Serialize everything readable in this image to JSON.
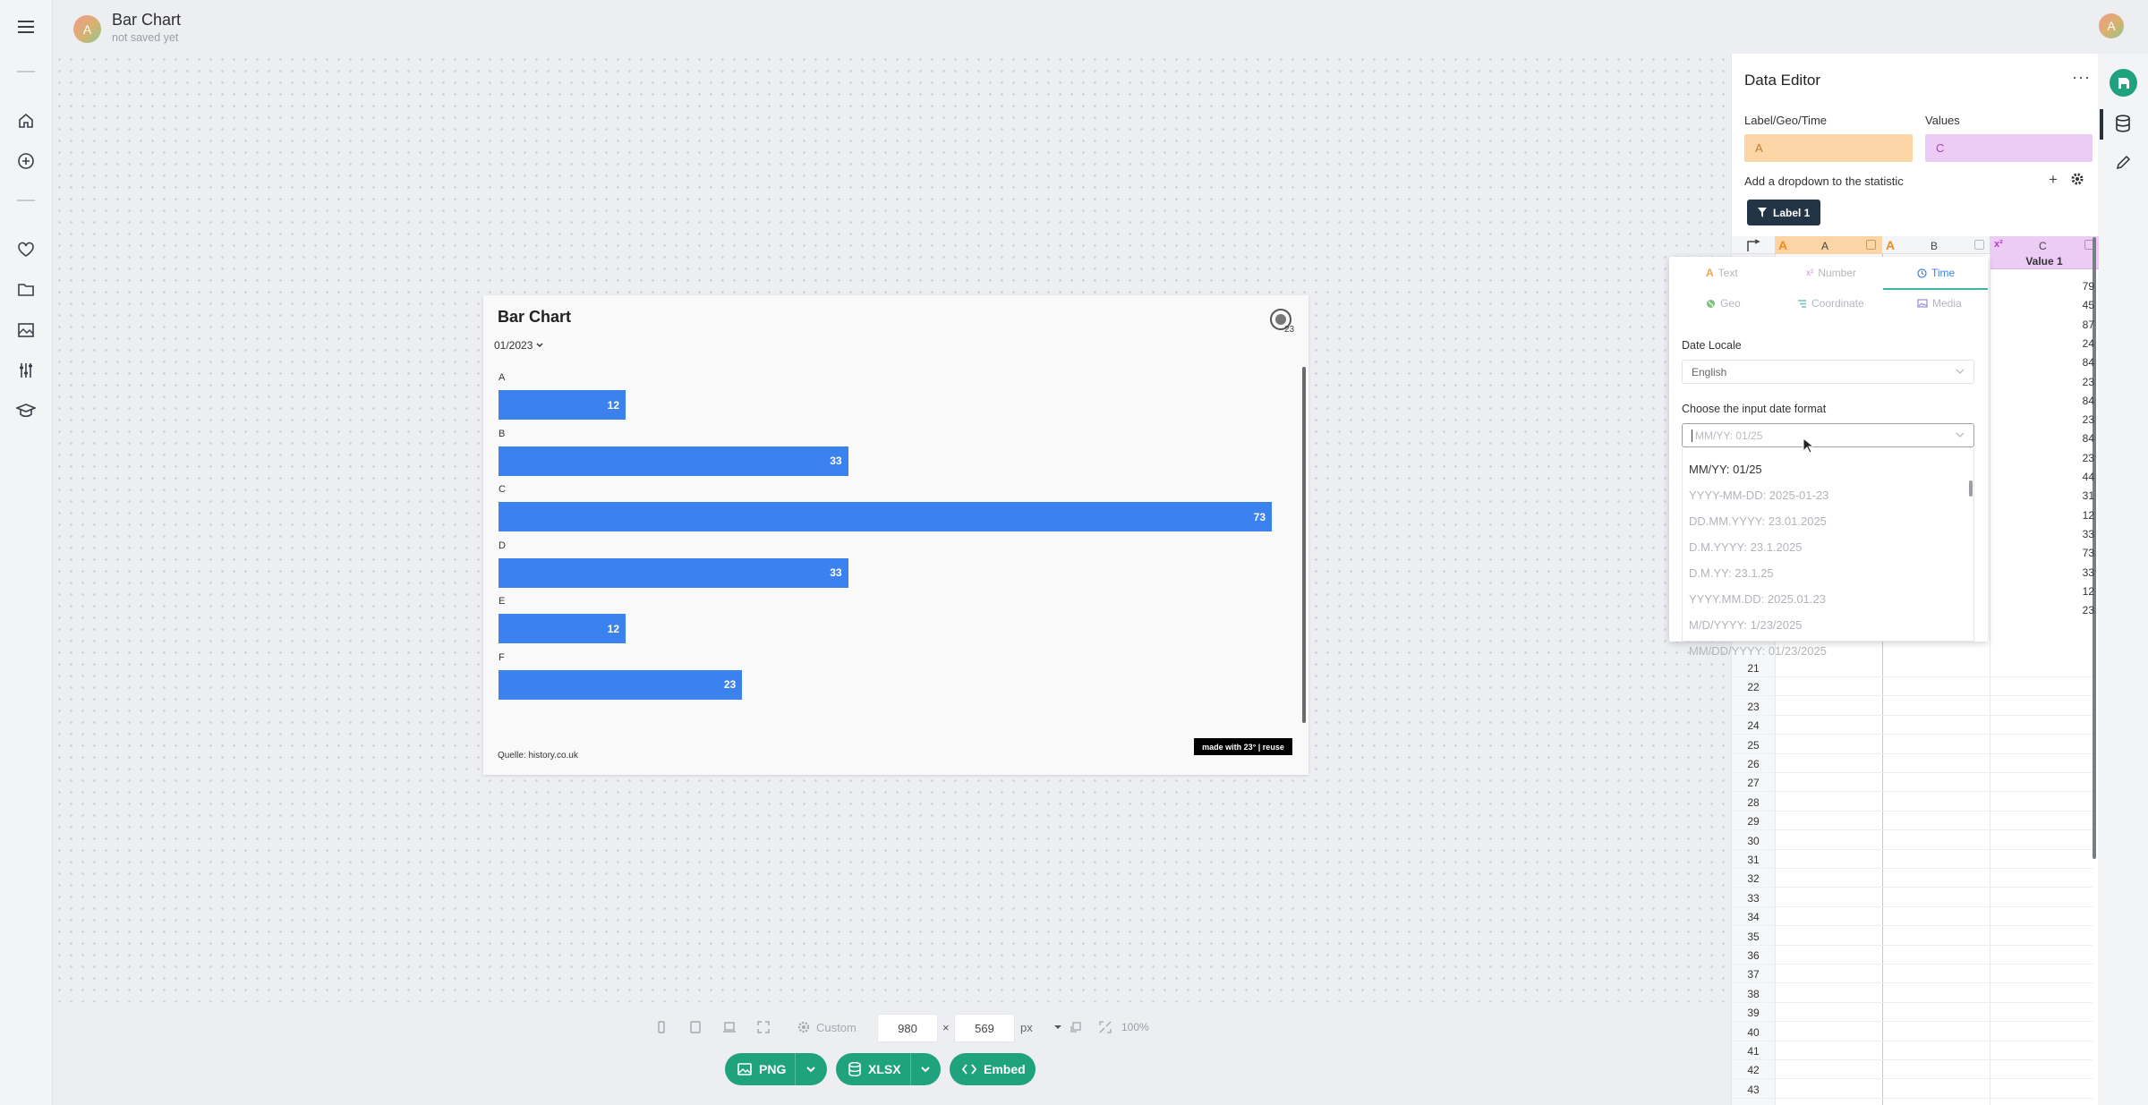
{
  "app": {
    "doc_title": "Bar Chart",
    "doc_status": "not saved yet",
    "user_initial": "A"
  },
  "sidebar": {
    "icons": [
      "menu-icon",
      "home-icon",
      "add-icon",
      "heart-icon",
      "folder-icon",
      "image-icon",
      "settings-sliders-icon",
      "graduation-cap-icon"
    ]
  },
  "chart": {
    "title": "Bar Chart",
    "period_select": "01/2023",
    "source": "Quelle: history.co.uk",
    "badge": "made with 23° | reuse",
    "chart_data": {
      "type": "bar",
      "orientation": "horizontal",
      "title": "Bar Chart",
      "categories": [
        "A",
        "B",
        "C",
        "D",
        "E",
        "F"
      ],
      "values": [
        12,
        33,
        73,
        33,
        12,
        23
      ],
      "xlim": [
        0,
        73
      ],
      "color": "#3b82ef"
    }
  },
  "toolbar": {
    "preset": "Custom",
    "width": "980",
    "height": "569",
    "times": "×",
    "unit": "px",
    "zoom": "100%",
    "export_png": "PNG",
    "export_xlsx": "XLSX",
    "embed": "Embed"
  },
  "editor": {
    "title": "Data Editor",
    "more": "···",
    "label_field_label": "Label/Geo/Time",
    "label_field_value": "A",
    "values_field_label": "Values",
    "values_field_value": "C",
    "add_dropdown": "Add a dropdown to the statistic",
    "plus": "+",
    "filter_chip": "Label 1",
    "columns": [
      "A",
      "B",
      "C"
    ],
    "col_c_header": "Value 1",
    "values_visible": [
      "79",
      "45",
      "87",
      "24",
      "84",
      "23",
      "84",
      "23",
      "84",
      "23",
      "44",
      "31",
      "12",
      "33",
      "73",
      "33",
      "12",
      "23"
    ],
    "row_numbers": [
      "21",
      "22",
      "23",
      "24",
      "25",
      "26",
      "27",
      "28",
      "29",
      "30",
      "31",
      "32",
      "33",
      "34",
      "35",
      "36",
      "37",
      "38",
      "39",
      "40",
      "41",
      "42",
      "43"
    ]
  },
  "type_popup": {
    "tabs": [
      "Text",
      "Number",
      "Time",
      "Geo",
      "Coordinate",
      "Media"
    ],
    "active_tab": "Time",
    "locale_label": "Date Locale",
    "locale_value": "English",
    "format_label": "Choose the input date format",
    "format_placeholder": "MM/YY: 01/25",
    "options": [
      "MM/YY: 01/25",
      "YYYY-MM-DD: 2025-01-23",
      "DD.MM.YYYY: 23.01.2025",
      "D.M.YYYY: 23.1.2025",
      "D.M.YY: 23.1.25",
      "YYYY.MM.DD: 2025.01.23",
      "M/D/YYYY: 1/23/2025",
      "MM/DD/YYYY: 01/23/2025"
    ]
  },
  "colors": {
    "accent": "#1fa27e",
    "bar": "#3b82ef",
    "label_col": "#fcd5a6",
    "value_col": "#eccbf4",
    "chip": "#243447"
  }
}
